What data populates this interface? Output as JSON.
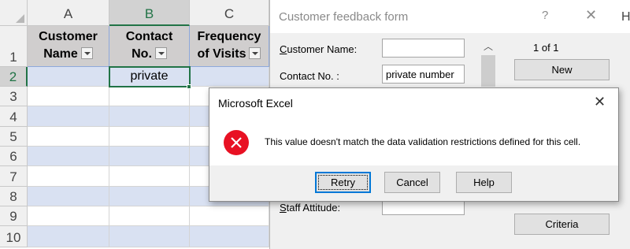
{
  "spreadsheet": {
    "columns": [
      "A",
      "B",
      "C"
    ],
    "selected_column": "B",
    "headers": [
      {
        "line1": "Customer",
        "line2": "Name"
      },
      {
        "line1": "Contact",
        "line2": "No."
      },
      {
        "line1": "Frequency",
        "line2": "of Visits"
      }
    ],
    "rows": [
      "1",
      "2",
      "3",
      "4",
      "5",
      "6",
      "7",
      "8",
      "9",
      "10"
    ],
    "selected_row": "2",
    "active_cell_value": "private",
    "colors": {
      "accent": "#217346",
      "banded_row": "#d9e1f2",
      "header_fill": "#d0cece"
    }
  },
  "form": {
    "title": "Customer feedback form",
    "help": "?",
    "close": "✕",
    "fields": [
      {
        "label": "Customer Name:",
        "value": ""
      },
      {
        "label": "Contact No. :",
        "value": "private number"
      },
      {
        "label": "Staff Attitude:",
        "value": ""
      }
    ],
    "record_counter": "1 of 1",
    "buttons": {
      "new": "New",
      "criteria": "Criteria"
    }
  },
  "sheet_edge_column": "H",
  "message_box": {
    "title": "Microsoft Excel",
    "close": "✕",
    "icon": "error-icon",
    "message": "This value doesn't match the data validation restrictions defined for this cell.",
    "buttons": {
      "retry": "Retry",
      "cancel": "Cancel",
      "help": "Help"
    },
    "colors": {
      "error_red": "#e81123",
      "focus_blue": "#0078d7"
    }
  }
}
